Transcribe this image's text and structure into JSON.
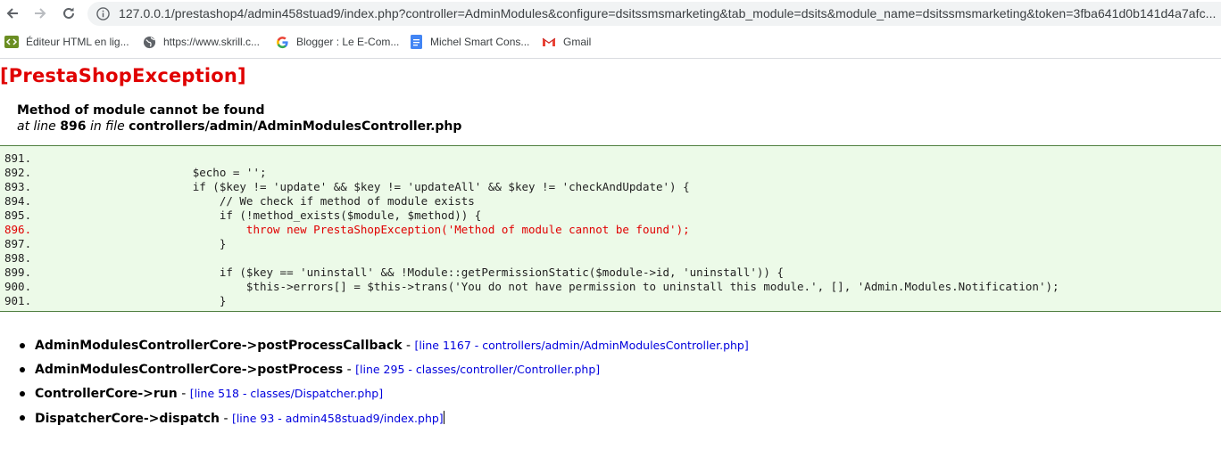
{
  "browser": {
    "url": "127.0.0.1/prestashop4/admin458stuad9/index.php?controller=AdminModules&configure=dsitssmsmarketing&tab_module=dsits&module_name=dsitssmsmarketing&token=3fba641d0b141d4a7afc...",
    "bookmarks": [
      {
        "label": "Éditeur HTML en lig...",
        "icon": "code-editor-icon"
      },
      {
        "label": "https://www.skrill.c...",
        "icon": "globe-icon"
      },
      {
        "label": "Blogger : Le E-Com...",
        "icon": "google-icon"
      },
      {
        "label": "Michel Smart Cons...",
        "icon": "docs-icon"
      },
      {
        "label": "Gmail",
        "icon": "gmail-icon"
      }
    ]
  },
  "exception": {
    "title": "[PrestaShopException]",
    "message": "Method of module cannot be found",
    "at_line_text": "at line",
    "line": "896",
    "in_file_text": "in file",
    "file": "controllers/admin/AdminModulesController.php"
  },
  "code": [
    {
      "num": "891.",
      "text": ""
    },
    {
      "num": "892.",
      "text": "                        $echo = '';"
    },
    {
      "num": "893.",
      "text": "                        if ($key != 'update' && $key != 'updateAll' && $key != 'checkAndUpdate') {"
    },
    {
      "num": "894.",
      "text": "                            // We check if method of module exists"
    },
    {
      "num": "895.",
      "text": "                            if (!method_exists($module, $method)) {"
    },
    {
      "num": "896.",
      "text": "                                throw new PrestaShopException('Method of module cannot be found');"
    },
    {
      "num": "897.",
      "text": "                            }"
    },
    {
      "num": "898.",
      "text": ""
    },
    {
      "num": "899.",
      "text": "                            if ($key == 'uninstall' && !Module::getPermissionStatic($module->id, 'uninstall')) {"
    },
    {
      "num": "900.",
      "text": "                                $this->errors[] = $this->trans('You do not have permission to uninstall this module.', [], 'Admin.Modules.Notification');"
    },
    {
      "num": "901.",
      "text": "                            }"
    }
  ],
  "highlight_line": "896.",
  "trace": [
    {
      "function": "AdminModulesControllerCore->postProcessCallback",
      "location": "[line 1167 - controllers/admin/AdminModulesController.php]"
    },
    {
      "function": "AdminModulesControllerCore->postProcess",
      "location": "[line 295 - classes/controller/Controller.php]"
    },
    {
      "function": "ControllerCore->run",
      "location": "[line 518 - classes/Dispatcher.php]"
    },
    {
      "function": "DispatcherCore->dispatch",
      "location": "[line 93 - admin458stuad9/index.php]"
    }
  ],
  "colors": {
    "exception_title": "#e00000",
    "code_background": "#ecfae8",
    "code_border": "#4f7f3f",
    "link": "#0000dd"
  }
}
